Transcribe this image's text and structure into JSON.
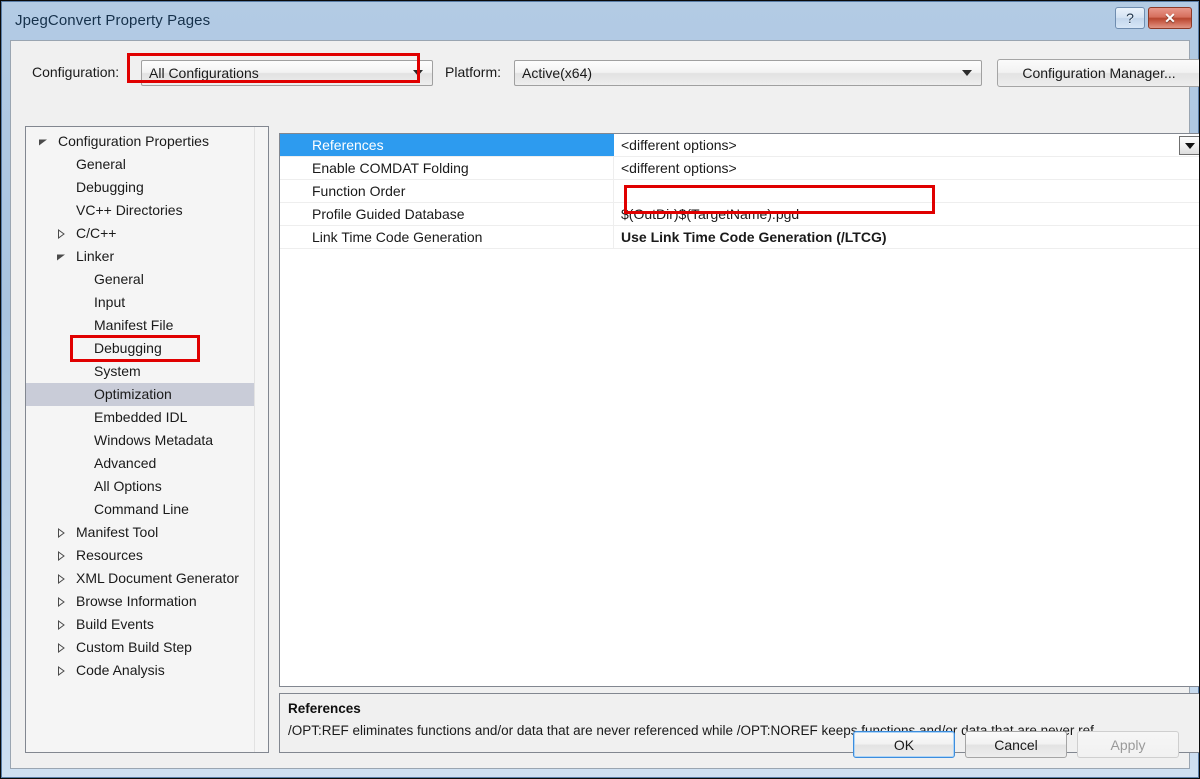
{
  "window": {
    "title": "JpegConvert Property Pages",
    "caption_buttons": [
      {
        "name": "help",
        "glyph": "?"
      },
      {
        "name": "close",
        "glyph": "✕"
      }
    ]
  },
  "toolbar": {
    "configuration_label": "Configuration:",
    "configuration_value": "All Configurations",
    "platform_label": "Platform:",
    "platform_value": "Active(x64)",
    "configuration_manager_label": "Configuration Manager..."
  },
  "tree": {
    "items": [
      {
        "label": "Configuration Properties",
        "indent": 0,
        "state": "expanded",
        "selected": false
      },
      {
        "label": "General",
        "indent": 1,
        "state": "leaf",
        "selected": false
      },
      {
        "label": "Debugging",
        "indent": 1,
        "state": "leaf",
        "selected": false
      },
      {
        "label": "VC++ Directories",
        "indent": 1,
        "state": "leaf",
        "selected": false
      },
      {
        "label": "C/C++",
        "indent": 1,
        "state": "collapsed",
        "selected": false
      },
      {
        "label": "Linker",
        "indent": 1,
        "state": "expanded",
        "selected": false
      },
      {
        "label": "General",
        "indent": 2,
        "state": "leaf",
        "selected": false
      },
      {
        "label": "Input",
        "indent": 2,
        "state": "leaf",
        "selected": false
      },
      {
        "label": "Manifest File",
        "indent": 2,
        "state": "leaf",
        "selected": false
      },
      {
        "label": "Debugging",
        "indent": 2,
        "state": "leaf",
        "selected": false
      },
      {
        "label": "System",
        "indent": 2,
        "state": "leaf",
        "selected": false
      },
      {
        "label": "Optimization",
        "indent": 2,
        "state": "leaf",
        "selected": true
      },
      {
        "label": "Embedded IDL",
        "indent": 2,
        "state": "leaf",
        "selected": false
      },
      {
        "label": "Windows Metadata",
        "indent": 2,
        "state": "leaf",
        "selected": false
      },
      {
        "label": "Advanced",
        "indent": 2,
        "state": "leaf",
        "selected": false
      },
      {
        "label": "All Options",
        "indent": 2,
        "state": "leaf",
        "selected": false
      },
      {
        "label": "Command Line",
        "indent": 2,
        "state": "leaf",
        "selected": false
      },
      {
        "label": "Manifest Tool",
        "indent": 1,
        "state": "collapsed",
        "selected": false
      },
      {
        "label": "Resources",
        "indent": 1,
        "state": "collapsed",
        "selected": false
      },
      {
        "label": "XML Document Generator",
        "indent": 1,
        "state": "collapsed",
        "selected": false
      },
      {
        "label": "Browse Information",
        "indent": 1,
        "state": "collapsed",
        "selected": false
      },
      {
        "label": "Build Events",
        "indent": 1,
        "state": "collapsed",
        "selected": false
      },
      {
        "label": "Custom Build Step",
        "indent": 1,
        "state": "collapsed",
        "selected": false
      },
      {
        "label": "Code Analysis",
        "indent": 1,
        "state": "collapsed",
        "selected": false
      }
    ]
  },
  "property_grid": {
    "rows": [
      {
        "name": "References",
        "value": "<different options>",
        "selected": true,
        "bold": false,
        "has_dropdown": true
      },
      {
        "name": "Enable COMDAT Folding",
        "value": "<different options>",
        "selected": false,
        "bold": false,
        "has_dropdown": false
      },
      {
        "name": "Function Order",
        "value": "",
        "selected": false,
        "bold": false,
        "has_dropdown": false
      },
      {
        "name": "Profile Guided Database",
        "value": "$(OutDir)$(TargetName).pgd",
        "selected": false,
        "bold": false,
        "has_dropdown": false
      },
      {
        "name": "Link Time Code Generation",
        "value": "Use Link Time Code Generation (/LTCG)",
        "selected": false,
        "bold": true,
        "has_dropdown": false
      }
    ]
  },
  "description": {
    "title": "References",
    "text": "/OPT:REF eliminates functions and/or data that are never referenced while /OPT:NOREF keeps functions and/or data that are never ref…"
  },
  "footer": {
    "ok_label": "OK",
    "cancel_label": "Cancel",
    "apply_label": "Apply"
  },
  "annotations": {
    "accent_color": "#e00000",
    "boxes": [
      {
        "name": "configuration-combo-highlight"
      },
      {
        "name": "optimization-tree-item-highlight"
      },
      {
        "name": "ltcg-value-highlight"
      }
    ]
  }
}
